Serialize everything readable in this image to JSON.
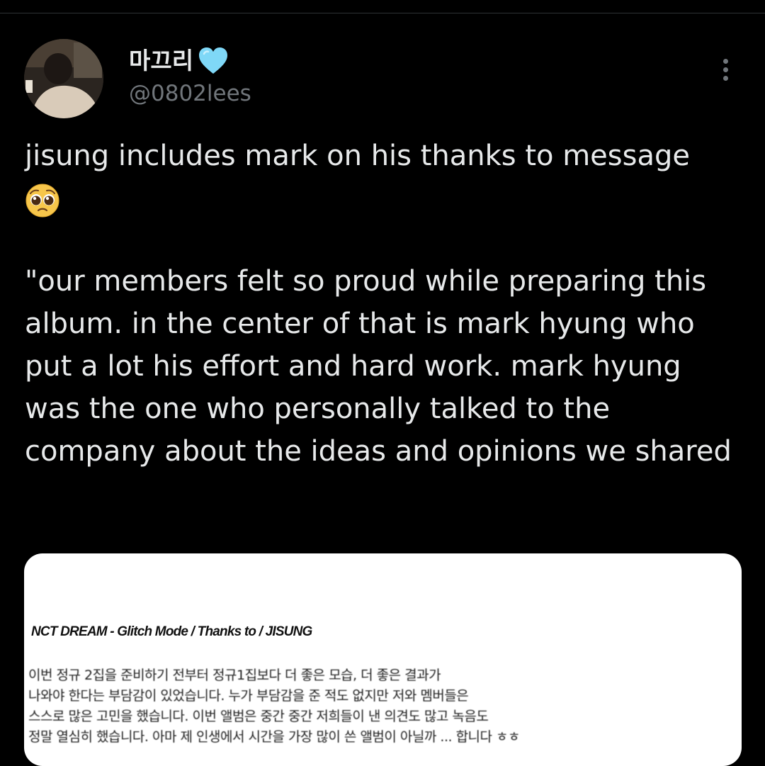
{
  "tweet": {
    "author": {
      "display_name": "마끄리",
      "handle": "@0802lees",
      "verified_emoji": "light-blue-heart"
    },
    "more_icon": "more-vertical-icon",
    "text_line1": "jisung includes mark on his thanks to message",
    "emoji": "pleading-face",
    "quote": "\"our members felt so proud while preparing this album. in the center of that is mark hyung who put a lot his effort and hard work. mark hyung was the one who personally talked to the company about the ideas and opinions we shared"
  },
  "media": {
    "doc_title": "NCT DREAM - Glitch Mode / Thanks to / JISUNG",
    "lines": [
      "이번 정규 2집을 준비하기 전부터 정규1집보다 더 좋은 모습, 더 좋은 결과가",
      "나와야 한다는 부담감이 있었습니다. 누가 부담감을 준 적도 없지만 저와 멤버들은",
      "스스로 많은 고민을 했습니다. 이번 앨범은 중간 중간 저희들이 낸 의견도 많고 녹음도",
      "정말 열심히 했습니다. 아마 제 인생에서 시간을 가장 많이 쓴 앨범이 아닐까 ... 합니다 ㅎㅎ"
    ]
  },
  "colors": {
    "background": "#000000",
    "text": "#e7e9ea",
    "secondary_text": "#71767b",
    "heart": "#7fd8f7"
  }
}
